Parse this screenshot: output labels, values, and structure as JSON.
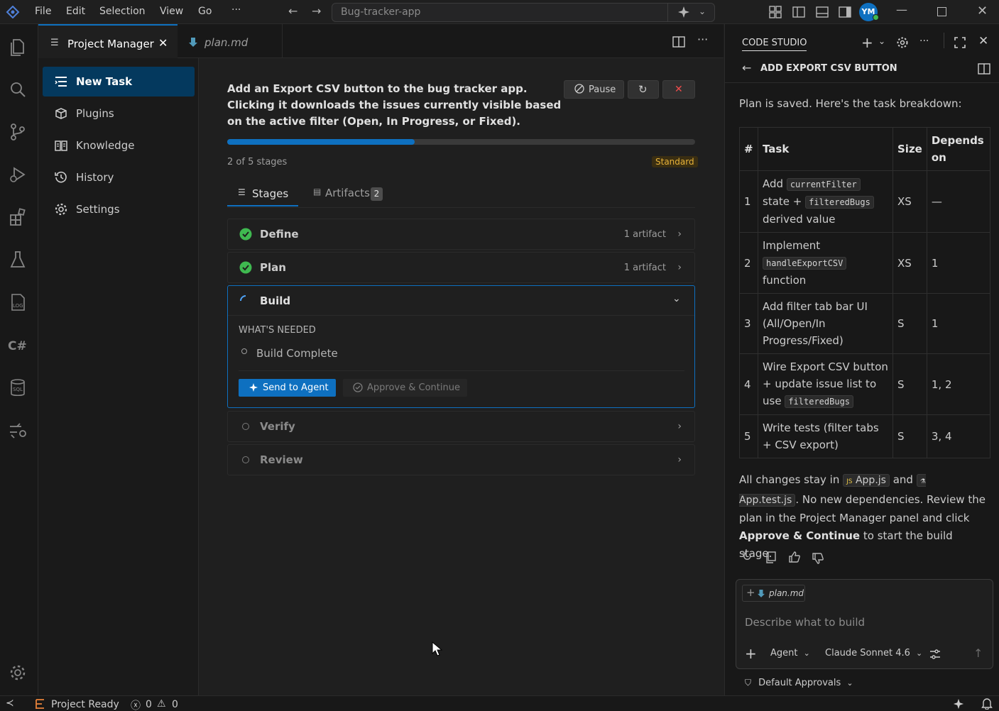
{
  "titlebar": {
    "menu": [
      "File",
      "Edit",
      "Selection",
      "View",
      "Go"
    ],
    "more": "···",
    "search_text": "Bug-tracker-app",
    "avatar_initials": "YM"
  },
  "sidebar": {
    "items": [
      {
        "label": "New Task",
        "icon": "new-task-icon",
        "active": true
      },
      {
        "label": "Plugins",
        "icon": "plugins-icon"
      },
      {
        "label": "Knowledge",
        "icon": "knowledge-icon"
      },
      {
        "label": "History",
        "icon": "history-icon"
      },
      {
        "label": "Settings",
        "icon": "settings-icon"
      }
    ]
  },
  "tabs": [
    {
      "label": "Project Manager",
      "active": true
    },
    {
      "label": "plan.md",
      "italic": true
    }
  ],
  "task": {
    "description": "Add an Export CSV button to the bug tracker app. Clicking it downloads the issues currently visible based on the active filter (Open, In Progress, or Fixed).",
    "pause_label": "Pause",
    "progress": 0.4,
    "stages_count": "2 of 5 stages",
    "badge": "Standard",
    "subtabs": {
      "stages": "Stages",
      "artifacts": "Artifacts",
      "artifacts_count": "2"
    }
  },
  "stages": {
    "define": {
      "name": "Define",
      "meta": "1 artifact",
      "status": "done"
    },
    "plan": {
      "name": "Plan",
      "meta": "1 artifact",
      "status": "done"
    },
    "build": {
      "name": "Build",
      "status": "running",
      "needed_title": "WHAT'S NEEDED",
      "needed_item": "Build Complete",
      "send_label": "Send to Agent",
      "approve_label": "Approve & Continue"
    },
    "verify": {
      "name": "Verify",
      "status": "pending"
    },
    "review": {
      "name": "Review",
      "status": "pending"
    }
  },
  "right": {
    "title": "CODE STUDIO",
    "subtitle": "ADD EXPORT CSV BUTTON",
    "intro": "Plan is saved. Here's the task breakdown:",
    "headers": {
      "num": "#",
      "task": "Task",
      "size": "Size",
      "depends": "Depends on"
    },
    "rows": [
      {
        "num": "1",
        "t1": "Add ",
        "c1": "currentFilter",
        "t2": " state + ",
        "c2": "filteredBugs",
        "t3": " derived value",
        "size": "XS",
        "dep": "—"
      },
      {
        "num": "2",
        "t1": "Implement ",
        "c1": "handleExportCSV",
        "t2": " function",
        "size": "XS",
        "dep": "1"
      },
      {
        "num": "3",
        "t1": "Add filter tab bar UI (All/Open/In Progress/Fixed)",
        "size": "S",
        "dep": "1"
      },
      {
        "num": "4",
        "t1": "Wire Export CSV button + update issue list to use ",
        "c1": "filteredBugs",
        "size": "S",
        "dep": "1, 2"
      },
      {
        "num": "5",
        "t1": "Write tests (filter tabs + CSV export)",
        "size": "S",
        "dep": "3, 4"
      }
    ],
    "msg": {
      "p1": "All changes stay in",
      "file1": "App.js",
      "p2": "and",
      "file2": "App.test.js",
      "p3": ". No new dependencies. Review the plan in the Project Manager panel and click",
      "bold": "Approve & Continue",
      "p4": "to start the build stage."
    },
    "chat": {
      "attachment": "plan.md",
      "placeholder": "Describe what to build",
      "mode": "Agent",
      "model": "Claude Sonnet 4.6",
      "approvals": "Default Approvals"
    }
  },
  "statusbar": {
    "project": "Project Ready",
    "errors": "0",
    "warnings": "0"
  },
  "colors": {
    "accent": "#0e70c0",
    "active_nav": "#04395e",
    "success": "#3fb950",
    "badge": "#b8860b"
  }
}
